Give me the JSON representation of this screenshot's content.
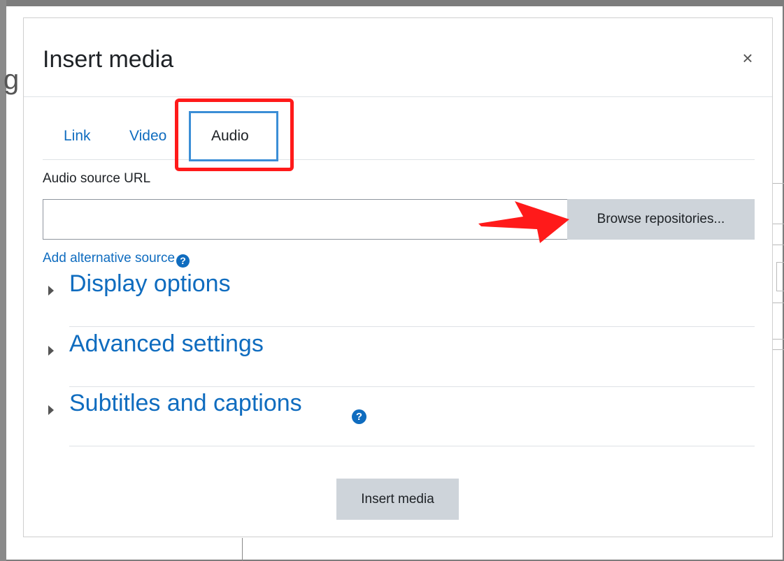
{
  "background": {
    "partial_heading": "g"
  },
  "modal": {
    "title": "Insert media",
    "close_symbol": "×",
    "tabs": [
      {
        "label": "Link"
      },
      {
        "label": "Video"
      },
      {
        "label": "Audio"
      }
    ],
    "active_tab": "Audio",
    "source_url": {
      "label": "Audio source URL",
      "value": "",
      "placeholder": ""
    },
    "browse_button": "Browse repositories...",
    "alt_source_link": "Add alternative source",
    "help_icon_glyph": "?",
    "sections": [
      {
        "label": "Display options"
      },
      {
        "label": "Advanced settings"
      },
      {
        "label": "Subtitles and captions"
      }
    ],
    "insert_button": "Insert media"
  },
  "annotations": {
    "highlight_color": "#ff1a1a",
    "tab_outline_color": "#3b8ed6",
    "arrow_color": "#ff1a1a"
  },
  "colors": {
    "link": "#0f6cbf",
    "button_bg": "#ced4da"
  }
}
